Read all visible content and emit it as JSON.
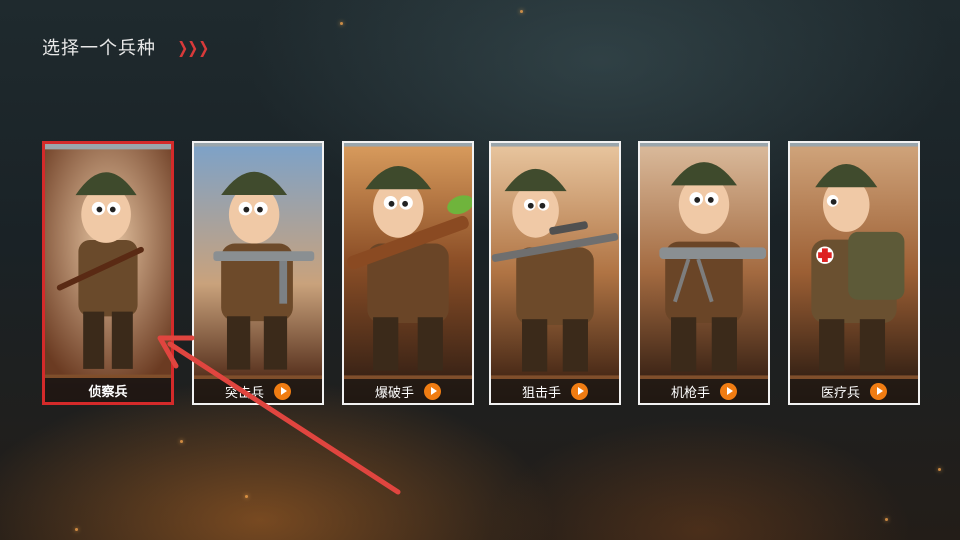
{
  "header": {
    "title": "选择一个兵种"
  },
  "theme": {
    "selected_border": "#d42a2a",
    "play_badge": "#f07c12",
    "arrow": "#e0453f"
  },
  "units": [
    {
      "label": "侦察兵",
      "selected": true,
      "icon": "scout-soldier"
    },
    {
      "label": "突击兵",
      "selected": false,
      "icon": "assault-soldier"
    },
    {
      "label": "爆破手",
      "selected": false,
      "icon": "demolition-soldier"
    },
    {
      "label": "狙击手",
      "selected": false,
      "icon": "sniper-soldier"
    },
    {
      "label": "机枪手",
      "selected": false,
      "icon": "machine-gunner-soldier"
    },
    {
      "label": "医疗兵",
      "selected": false,
      "icon": "medic-soldier"
    }
  ]
}
